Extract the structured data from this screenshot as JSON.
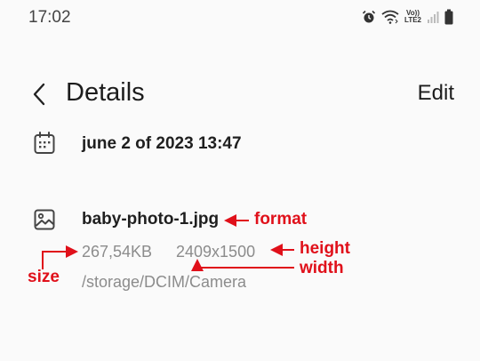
{
  "status_bar": {
    "time": "17:02",
    "icons": [
      "alarm-icon",
      "wifi-icon",
      "volte-lte2-icon",
      "signal-icon",
      "battery-icon"
    ],
    "volte_top": "Vo))",
    "volte_bottom": "LTE2"
  },
  "header": {
    "back_icon": "chevron-left-icon",
    "title": "Details",
    "edit_label": "Edit"
  },
  "date_row": {
    "icon": "calendar-icon",
    "text": "june 2 of 2023 13:47"
  },
  "file_row": {
    "icon": "image-icon",
    "name": "baby-photo-1.jpg",
    "size": "267,54KB",
    "resolution": "2409x1500",
    "path": "/storage/DCIM/Camera"
  },
  "annotations": {
    "format": "format",
    "height": "height",
    "width": "width",
    "size": "size",
    "color": "#e0101a"
  }
}
